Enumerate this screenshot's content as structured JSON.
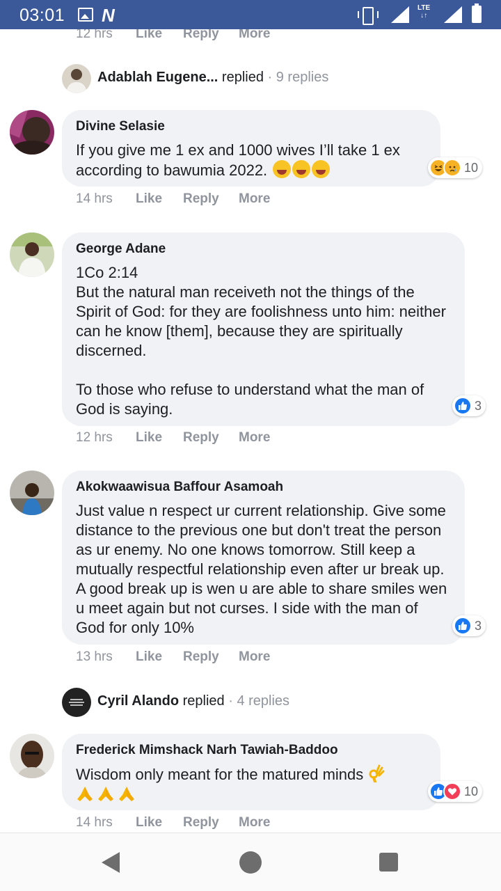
{
  "status_bar": {
    "time": "03:01",
    "notification_icons": [
      "image-icon",
      "n-icon"
    ],
    "network_label": "LTE",
    "right_icons": [
      "vibrate-icon",
      "signal-icon",
      "lte-signal-icon",
      "battery-icon"
    ]
  },
  "actions": {
    "like": "Like",
    "reply": "Reply",
    "more": "More"
  },
  "feed": {
    "top_meta": {
      "time": "12 hrs"
    },
    "thread_1": {
      "name": "Adablah Eugene...",
      "verb": "replied",
      "count": "· 9 replies"
    },
    "comments": [
      {
        "name": "Divine Selasie",
        "text": "If you give me 1 ex and 1000 wives I’ll take 1 ex according to bawumia 2022.",
        "inline_emoji": [
          "laughing-tears-emoji",
          "laughing-tears-emoji",
          "laughing-tears-emoji"
        ],
        "reaction_icons": [
          "haha-reaction-icon",
          "sad-reaction-icon"
        ],
        "reaction_count": "10",
        "time": "14 hrs"
      },
      {
        "name": "George Adane",
        "text": "1Co 2:14\nBut the natural man receiveth not the things of the Spirit of God: for they are foolishness unto him: neither can he know [them], because they are spiritually discerned.\n\nTo those who refuse to understand what the man of God is saying.",
        "reaction_icons": [
          "like-reaction-icon"
        ],
        "reaction_count": "3",
        "time": "12 hrs"
      },
      {
        "name": "Akokwaawisua Baffour Asamoah",
        "text": "Just value n respect ur current relationship. Give some distance to the previous one but don't treat the person as ur enemy. No one knows tomorrow. Still keep a mutually respectful relationship even after ur break up. A good break up is wen u are able to share smiles wen u meet again but not curses. I side with the man of God for only 10%",
        "reaction_icons": [
          "like-reaction-icon"
        ],
        "reaction_count": "3",
        "time": "13 hrs"
      },
      {
        "name": "Frederick Mimshack Narh Tawiah-Baddoo",
        "text": "Wisdom only meant for the matured minds",
        "inline_emoji": [
          "ok-hand-emoji",
          "praying-hands-emoji",
          "praying-hands-emoji",
          "praying-hands-emoji"
        ],
        "reaction_icons": [
          "like-reaction-icon",
          "love-reaction-icon"
        ],
        "reaction_count": "10",
        "time": "14 hrs"
      }
    ],
    "thread_2": {
      "name": "Cyril Alando",
      "verb": "replied",
      "count": "· 4 replies"
    }
  },
  "nav_bar": {
    "icons": [
      "back-icon",
      "home-icon",
      "recents-icon"
    ]
  },
  "colors": {
    "status_bar": "#3b5998",
    "bubble": "#f0f2f5",
    "meta_text": "#90949c",
    "like_blue": "#1877f2",
    "love_red": "#f33e58",
    "nav_icon": "#6d6d6d"
  }
}
